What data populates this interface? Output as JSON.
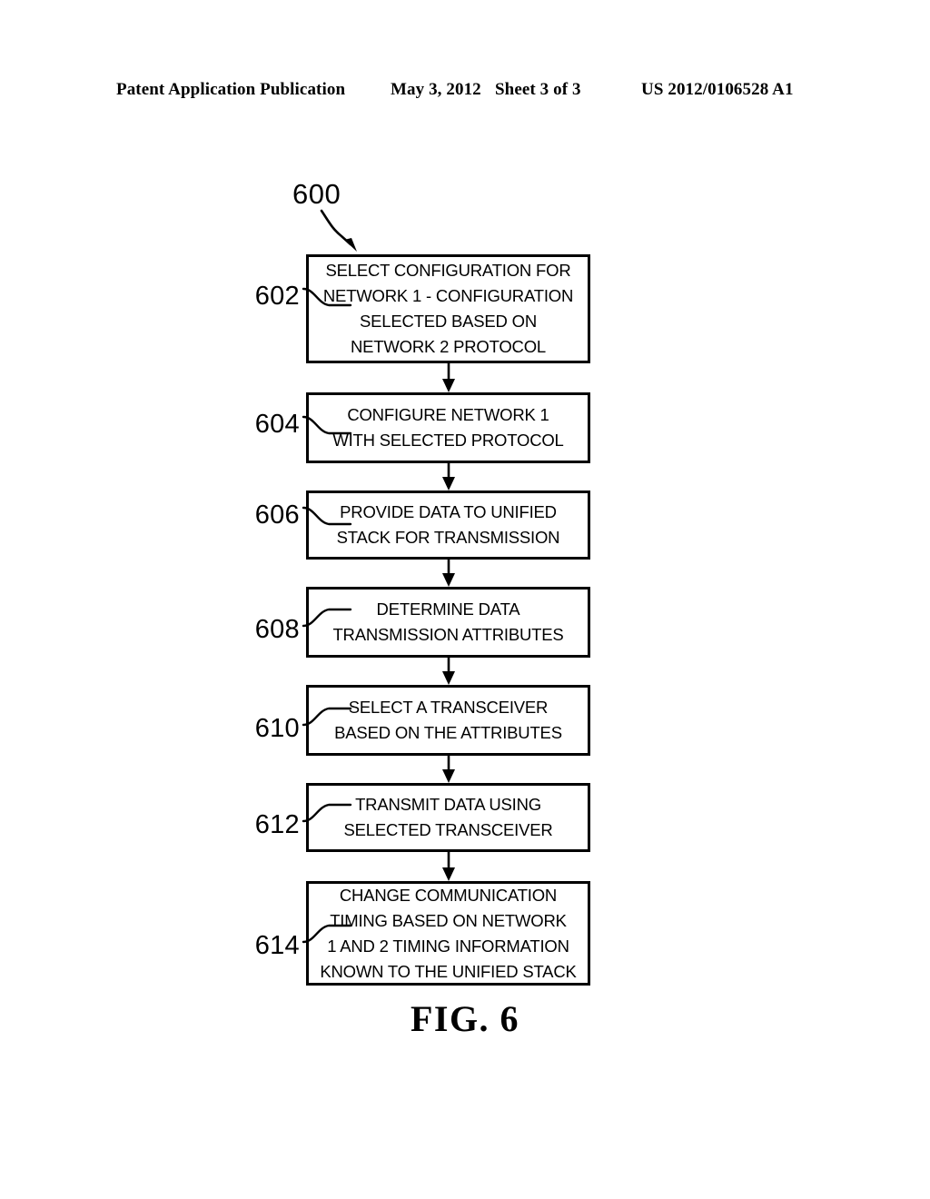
{
  "header": {
    "publication": "Patent Application Publication",
    "date": "May 3, 2012",
    "sheet": "Sheet 3 of 3",
    "publication_number": "US 2012/0106528 A1"
  },
  "figure": {
    "caption": "FIG. 6",
    "diagram_ref": "600",
    "line_color": "#000000",
    "background_color": "#ffffff"
  },
  "flowchart": {
    "type": "flowchart",
    "orientation": "vertical",
    "steps": [
      {
        "ref": "602",
        "text": "SELECT CONFIGURATION FOR\nNETWORK 1 - CONFIGURATION\nSELECTED BASED ON\nNETWORK 2 PROTOCOL",
        "lines": 4
      },
      {
        "ref": "604",
        "text": "CONFIGURE NETWORK 1\nWITH SELECTED PROTOCOL",
        "lines": 2
      },
      {
        "ref": "606",
        "text": "PROVIDE DATA TO UNIFIED\nSTACK FOR TRANSMISSION",
        "lines": 2
      },
      {
        "ref": "608",
        "text": "DETERMINE DATA\nTRANSMISSION ATTRIBUTES",
        "lines": 2
      },
      {
        "ref": "610",
        "text": "SELECT A TRANSCEIVER\nBASED ON THE ATTRIBUTES",
        "lines": 2
      },
      {
        "ref": "612",
        "text": "TRANSMIT DATA USING\nSELECTED TRANSCEIVER",
        "lines": 2
      },
      {
        "ref": "614",
        "text": "CHANGE COMMUNICATION\nTIMING BASED ON NETWORK\n1 AND 2 TIMING INFORMATION\nKNOWN TO THE UNIFIED STACK",
        "lines": 4
      }
    ],
    "connectors": [
      {
        "from": "602",
        "to": "604",
        "style": "arrow-down"
      },
      {
        "from": "604",
        "to": "606",
        "style": "arrow-down"
      },
      {
        "from": "606",
        "to": "608",
        "style": "arrow-down"
      },
      {
        "from": "608",
        "to": "610",
        "style": "arrow-down"
      },
      {
        "from": "610",
        "to": "612",
        "style": "arrow-down"
      },
      {
        "from": "612",
        "to": "614",
        "style": "arrow-down"
      }
    ]
  }
}
